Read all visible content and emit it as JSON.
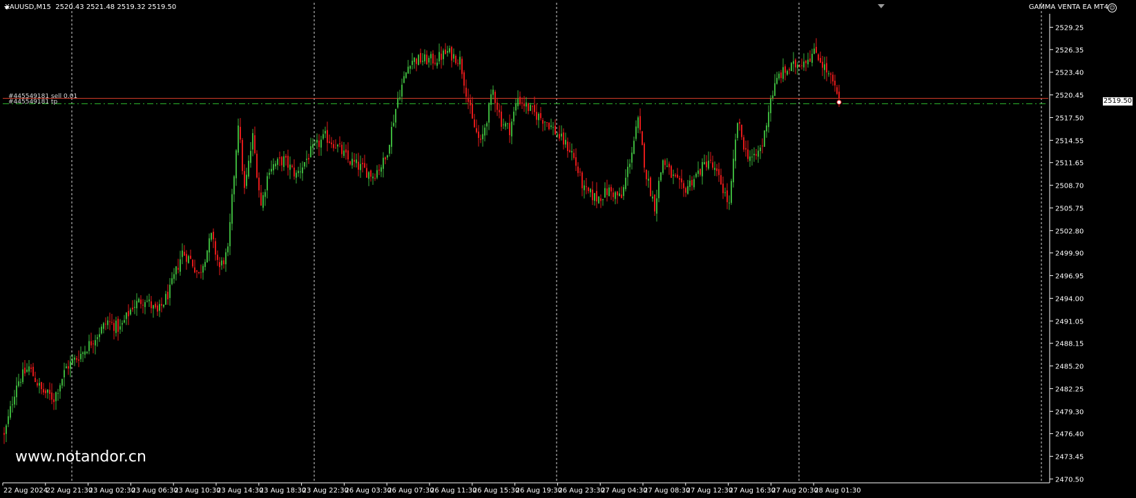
{
  "header": {
    "symbol": "XAUUSD,M15",
    "ohlc": "2520.43 2521.48 2519.32 2519.50",
    "ea_name": "GAMMA VENTA EA MT4"
  },
  "watermark": "www.notandor.cn",
  "orders": {
    "sell_label": "#445549181 sell 0.01",
    "tp_label": "#445549181 tp",
    "entry_price": 2520.0,
    "tp_price": 2519.3
  },
  "bid_tag": "2519.50",
  "colors": {
    "background": "#000000",
    "bull": "#3cb33c",
    "bear": "#e31a1a",
    "grid": "#ffffff",
    "axis": "#ffffff",
    "sell_line": "#e0402c",
    "tp_line": "#2fbf2f"
  },
  "chart_data": {
    "type": "candlestick",
    "title": "XAUUSD,M15",
    "timeframe": "M15",
    "ylim": [
      2470.0,
      2531.0
    ],
    "y_ticks": [
      "2529.25",
      "2526.35",
      "2523.40",
      "2520.45",
      "2517.50",
      "2514.55",
      "2511.65",
      "2508.70",
      "2505.75",
      "2502.80",
      "2499.90",
      "2496.95",
      "2494.00",
      "2491.05",
      "2488.15",
      "2485.20",
      "2482.25",
      "2479.30",
      "2476.40",
      "2473.45",
      "2470.50"
    ],
    "x_labels": [
      "22 Aug 2024",
      "22 Aug 21:30",
      "23 Aug 02:30",
      "23 Aug 06:30",
      "23 Aug 10:30",
      "23 Aug 14:30",
      "23 Aug 18:30",
      "23 Aug 22:30",
      "26 Aug 03:30",
      "26 Aug 07:30",
      "26 Aug 11:30",
      "26 Aug 15:30",
      "26 Aug 19:30",
      "26 Aug 23:30",
      "27 Aug 04:30",
      "27 Aug 08:30",
      "27 Aug 12:30",
      "27 Aug 16:30",
      "27 Aug 20:30",
      "28 Aug 01:30"
    ],
    "grid": "vertical dashed",
    "last_price": 2519.5,
    "close_path": [
      [
        0,
        2476
      ],
      [
        6,
        2483
      ],
      [
        12,
        2485
      ],
      [
        18,
        2482
      ],
      [
        24,
        2481
      ],
      [
        30,
        2485
      ],
      [
        38,
        2487
      ],
      [
        44,
        2489
      ],
      [
        50,
        2491
      ],
      [
        56,
        2490
      ],
      [
        62,
        2493
      ],
      [
        68,
        2494
      ],
      [
        74,
        2492
      ],
      [
        80,
        2495
      ],
      [
        86,
        2500
      ],
      [
        90,
        2499
      ],
      [
        94,
        2497
      ],
      [
        100,
        2502
      ],
      [
        104,
        2498
      ],
      [
        108,
        2500
      ],
      [
        113,
        2517
      ],
      [
        116,
        2508
      ],
      [
        120,
        2515
      ],
      [
        124,
        2506
      ],
      [
        128,
        2511
      ],
      [
        135,
        2512
      ],
      [
        141,
        2510
      ],
      [
        148,
        2513
      ],
      [
        155,
        2515
      ],
      [
        160,
        2514
      ],
      [
        166,
        2512
      ],
      [
        172,
        2511
      ],
      [
        178,
        2510
      ],
      [
        184,
        2512
      ],
      [
        190,
        2520
      ],
      [
        196,
        2525
      ],
      [
        202,
        2525
      ],
      [
        208,
        2525
      ],
      [
        214,
        2526
      ],
      [
        220,
        2525
      ],
      [
        226,
        2517
      ],
      [
        230,
        2514
      ],
      [
        236,
        2521
      ],
      [
        240,
        2517
      ],
      [
        244,
        2516
      ],
      [
        248,
        2520
      ],
      [
        252,
        2519
      ],
      [
        256,
        2518
      ],
      [
        262,
        2517
      ],
      [
        268,
        2515
      ],
      [
        274,
        2513
      ],
      [
        280,
        2508
      ],
      [
        286,
        2507
      ],
      [
        292,
        2508
      ],
      [
        298,
        2507
      ],
      [
        302,
        2512
      ],
      [
        306,
        2517
      ],
      [
        310,
        2510
      ],
      [
        314,
        2506
      ],
      [
        318,
        2512
      ],
      [
        322,
        2510
      ],
      [
        328,
        2508
      ],
      [
        334,
        2510
      ],
      [
        340,
        2512
      ],
      [
        346,
        2509
      ],
      [
        350,
        2506
      ],
      [
        354,
        2517
      ],
      [
        358,
        2513
      ],
      [
        362,
        2512
      ],
      [
        366,
        2514
      ],
      [
        370,
        2520
      ],
      [
        374,
        2523
      ],
      [
        380,
        2524
      ],
      [
        386,
        2525
      ],
      [
        392,
        2526
      ],
      [
        396,
        2524
      ],
      [
        400,
        2522
      ],
      [
        403,
        2519.5
      ]
    ]
  }
}
